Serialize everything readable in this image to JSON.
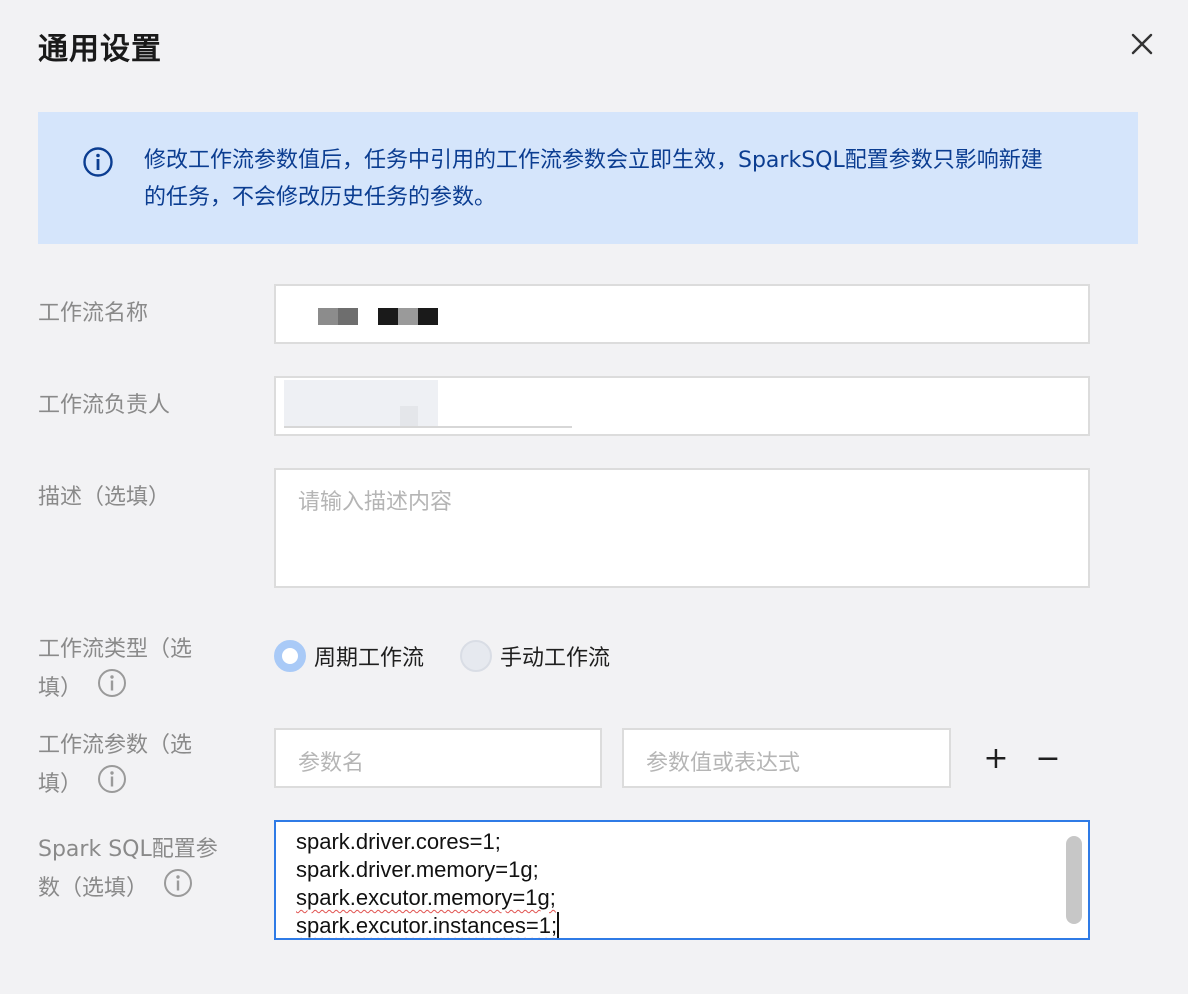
{
  "dialog": {
    "title": "通用设置",
    "close_icon": "close-icon"
  },
  "notice": {
    "icon": "info-circle-icon",
    "text": "修改工作流参数值后，任务中引用的工作流参数会立即生效，SparkSQL配置参数只影响新建的任务，不会修改历史任务的参数。",
    "color": "#0b3d91",
    "background": "#d5e5fb"
  },
  "form": {
    "workflow_name": {
      "label": "工作流名称"
    },
    "workflow_owner": {
      "label": "工作流负责人"
    },
    "description": {
      "label": "描述（选填）",
      "placeholder": "请输入描述内容"
    },
    "workflow_type": {
      "label_line1": "工作流类型（选",
      "label_line2": "填）",
      "info_icon": "info-circle-icon",
      "options": [
        {
          "label": "周期工作流",
          "checked": true
        },
        {
          "label": "手动工作流",
          "checked": false
        }
      ]
    },
    "workflow_params": {
      "label_line1": "工作流参数（选",
      "label_line2": "填）",
      "info_icon": "info-circle-icon",
      "name_placeholder": "参数名",
      "value_placeholder": "参数值或表达式",
      "add": "+",
      "remove": "−"
    },
    "spark_sql": {
      "label_line1": "Spark SQL配置参",
      "label_line2": "数（选填）",
      "info_icon": "info-circle-icon",
      "lines": [
        "spark.driver.cores=1;",
        "spark.driver.memory=1g;",
        "spark.excutor.memory=1g;",
        "spark.excutor.instances=1;"
      ]
    }
  },
  "colors": {
    "accent": "#2f7be6",
    "radio_checked_ring": "#a9caf7"
  }
}
